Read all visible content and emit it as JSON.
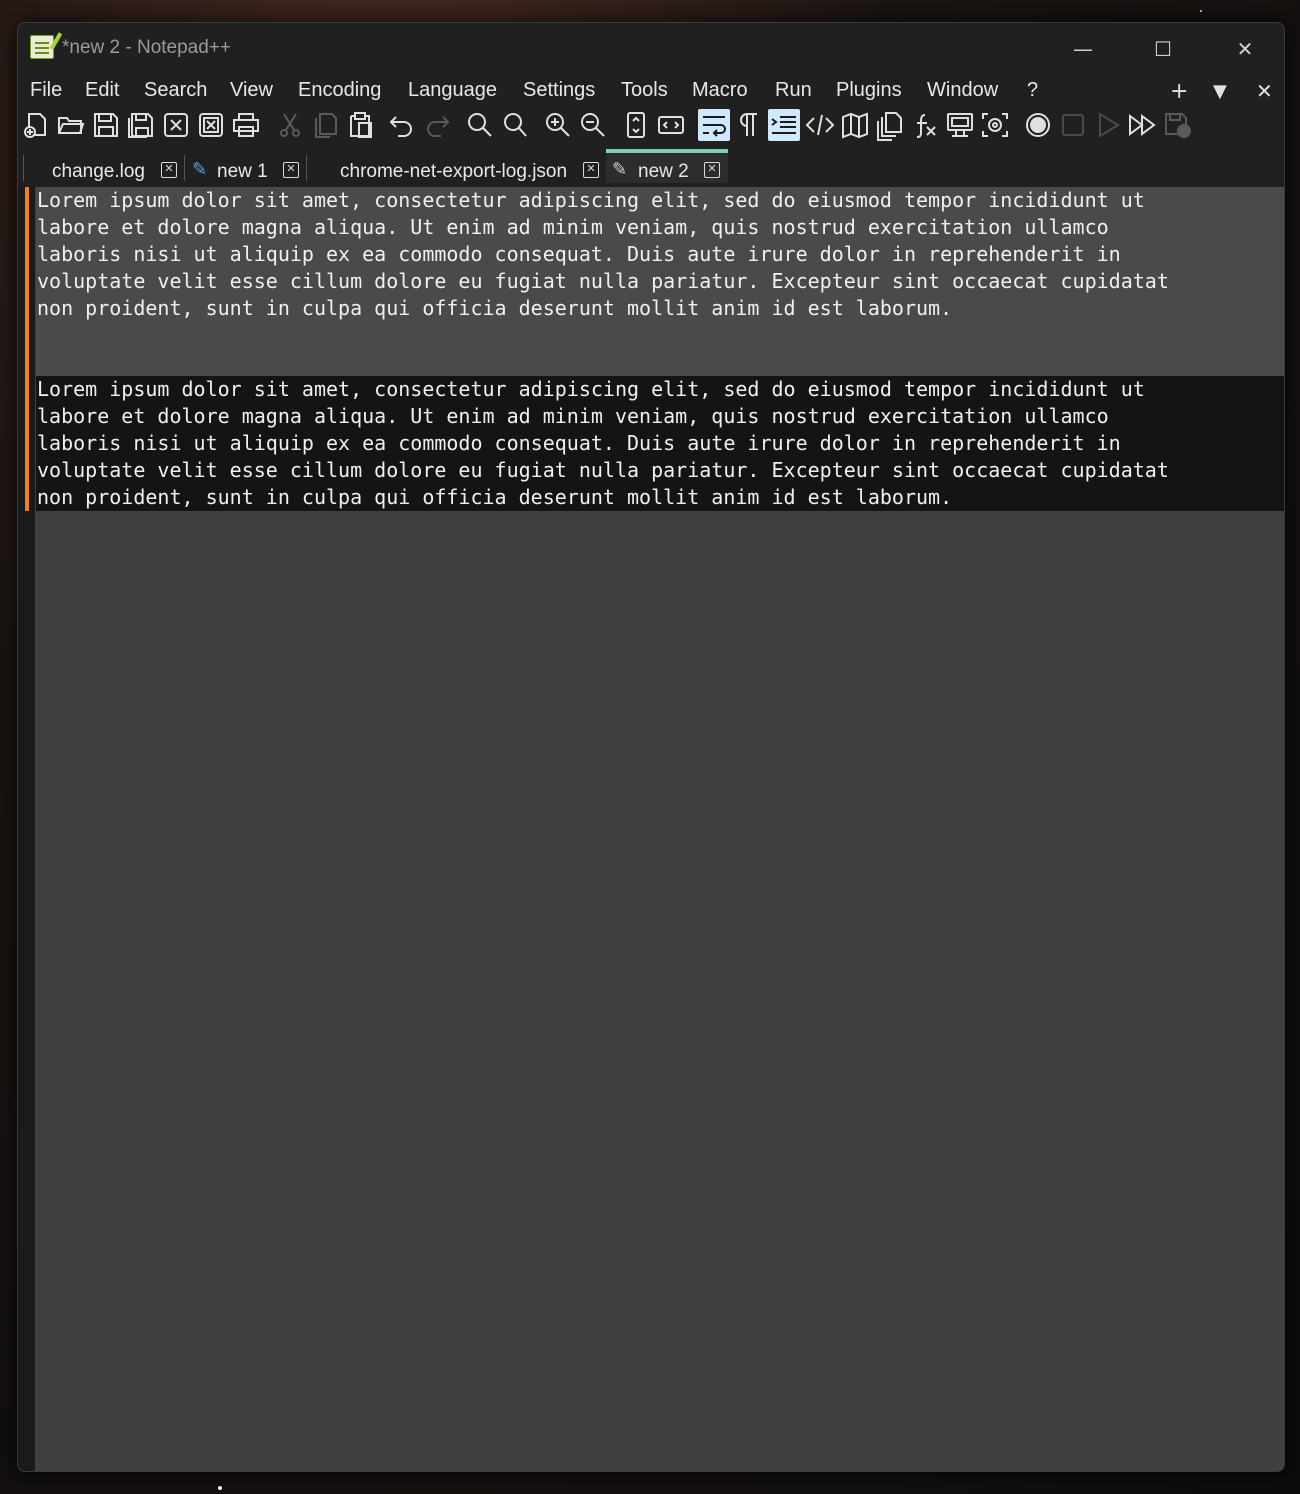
{
  "window": {
    "title": "*new 2 - Notepad++"
  },
  "menu": {
    "items": [
      "File",
      "Edit",
      "Search",
      "View",
      "Encoding",
      "Language",
      "Settings",
      "Tools",
      "Macro",
      "Run",
      "Plugins",
      "Window",
      "?"
    ],
    "right": {
      "add": "+",
      "dropdown": "▼",
      "close": "✕"
    }
  },
  "toolbar": {
    "buttons": [
      "new-file",
      "open",
      "save",
      "save-all",
      "close",
      "close-all",
      "print",
      "cut",
      "copy",
      "paste",
      "undo",
      "redo",
      "find",
      "replace",
      "zoom-in",
      "zoom-out",
      "sync-vertical",
      "sync-horizontal",
      "word-wrap",
      "show-all-characters",
      "indent-guide",
      "udl",
      "document-map",
      "document-list",
      "function-list",
      "folder-as-workspace",
      "monitoring",
      "record-macro",
      "stop-recording",
      "playback",
      "run-macro-multiple",
      "save-macro"
    ]
  },
  "tabs": [
    {
      "label": "change.log",
      "modified": false,
      "active": false
    },
    {
      "label": "new 1",
      "modified": true,
      "active": false
    },
    {
      "label": "chrome-net-export-log.json",
      "modified": false,
      "active": false
    },
    {
      "label": "new 2",
      "modified": true,
      "active": true
    }
  ],
  "editor": {
    "paragraph1": "Lorem ipsum dolor sit amet, consectetur adipiscing elit, sed do eiusmod tempor incididunt ut\nlabore et dolore magna aliqua. Ut enim ad minim veniam, quis nostrud exercitation ullamco\nlaboris nisi ut aliquip ex ea commodo consequat. Duis aute irure dolor in reprehenderit in\nvoluptate velit esse cillum dolore eu fugiat nulla pariatur. Excepteur sint occaecat cupidatat\nnon proident, sunt in culpa qui officia deserunt mollit anim id est laborum.",
    "paragraph2": "Lorem ipsum dolor sit amet, consectetur adipiscing elit, sed do eiusmod tempor incididunt ut\nlabore et dolore magna aliqua. Ut enim ad minim veniam, quis nostrud exercitation ullamco\nlaboris nisi ut aliquip ex ea commodo consequat. Duis aute irure dolor in reprehenderit in\nvoluptate velit esse cillum dolore eu fugiat nulla pariatur. Excepteur sint occaecat cupidatat\nnon proident, sunt in culpa qui officia deserunt mollit anim id est laborum."
  },
  "colors": {
    "accent_tab": "#7fd0b0",
    "change_marker": "#f0801a",
    "editor_bg": "#404040",
    "current_block_bg": "#141414"
  }
}
